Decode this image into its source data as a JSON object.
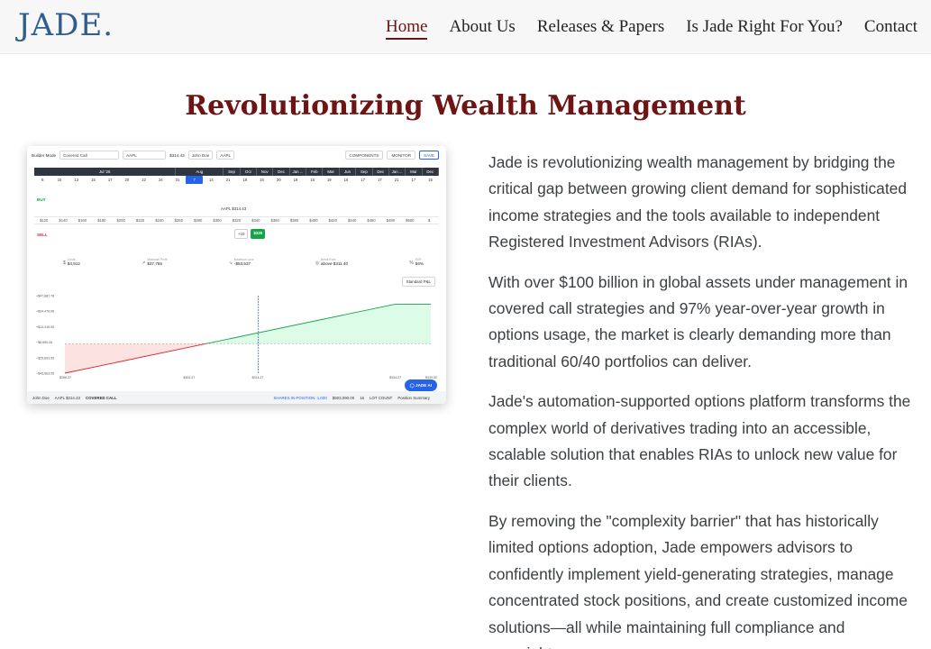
{
  "header": {
    "logo": "JADE.",
    "nav": [
      {
        "label": "Home",
        "active": true
      },
      {
        "label": "About Us"
      },
      {
        "label": "Releases & Papers"
      },
      {
        "label": "Is Jade Right For You?"
      },
      {
        "label": "Contact"
      }
    ]
  },
  "title": "Revolutionizing Wealth Management",
  "screenshot": {
    "toolbar": {
      "builder_mode_label": "Builder Mode",
      "strategy": "Covered Call",
      "ticker": "AAPL",
      "price": "$314.43",
      "client": "John Doe",
      "ticker_chip": "AAPL",
      "components": "COMPONENTS",
      "monitor": "MONITOR",
      "save": "SAVE"
    },
    "months": [
      {
        "label": "Jul '26",
        "weight": 9
      },
      {
        "label": "Aug",
        "weight": 3
      },
      {
        "label": "Sep",
        "weight": 1
      },
      {
        "label": "Oct",
        "weight": 1
      },
      {
        "label": "Nov",
        "weight": 1
      },
      {
        "label": "Dec",
        "weight": 1
      },
      {
        "label": "Jan ...",
        "weight": 1
      },
      {
        "label": "Feb",
        "weight": 1
      },
      {
        "label": "Mar",
        "weight": 1
      },
      {
        "label": "Jun",
        "weight": 1
      },
      {
        "label": "Sep",
        "weight": 1
      },
      {
        "label": "Dec",
        "weight": 1
      },
      {
        "label": "Jan ...",
        "weight": 1
      },
      {
        "label": "Mar",
        "weight": 1
      },
      {
        "label": "Dec",
        "weight": 1
      }
    ],
    "days": [
      "6",
      "10",
      "13",
      "15",
      "17",
      "20",
      "22",
      "24",
      "31",
      "7",
      "14",
      "21",
      "18",
      "16",
      "20",
      "18",
      "15",
      "19",
      "16",
      "17",
      "17",
      "21",
      "17",
      "15"
    ],
    "selected_day_index": 9,
    "buy_label": "BUY",
    "sell_label": "SELL",
    "ticker_label": "AAPL $314.43",
    "strikes": [
      "$120",
      "$140",
      "$160",
      "$180",
      "$200",
      "$220",
      "$240",
      "$260",
      "$280",
      "$300",
      "$320",
      "$340",
      "$360",
      "$380",
      "$400",
      "$420",
      "$440",
      "$460",
      "$480",
      "$500",
      "$"
    ],
    "chips": [
      "+10",
      "$320"
    ],
    "stats": [
      {
        "label": "Credit",
        "value": "$4,912"
      },
      {
        "label": "Maximum Profit",
        "value": "$37,755"
      },
      {
        "label": "Maximum Loss",
        "value": "-$53,537"
      },
      {
        "label": "Break Even",
        "value": "above $311.40"
      },
      {
        "label": "POP",
        "value": "56%"
      }
    ],
    "pnl_dropdown": "Standard P&L",
    "chart_data": {
      "type": "line",
      "y_ticks": [
        "+$47,887.78",
        "+$34,476.96",
        "+$14,416.06",
        "−$8,690.06",
        "−$25,603.95",
        "−$43,563.05"
      ],
      "x_ticks": [
        "$286.27",
        "$304.27",
        "$314.27",
        "$334.27",
        "$339.50"
      ],
      "payoff_points": [
        {
          "x": 286.27,
          "y": -43563.05
        },
        {
          "x": 334.27,
          "y": 37755
        },
        {
          "x": 339.5,
          "y": 37755
        }
      ],
      "breakeven_line": "-8690.06",
      "current_price_marker": 314.43
    },
    "footer": {
      "client": "John Doe",
      "ticker": "AAPL $314.43",
      "strategy": "COVERED CALL",
      "shares": "SHARES IN POSITION: 1,000",
      "position_value": "$503,090.00",
      "lots": "16",
      "lot_count": "LOT COUNT",
      "summary": "Position Summary"
    },
    "ai_button": "JADE AI"
  },
  "paragraphs": [
    "Jade is revolutionizing wealth management by bridging the critical gap between growing client demand for sophisticated income strategies and the tools available to independent Registered Investment Advisors (RIAs).",
    "With over $100 billion in global assets under management in covered call strategies and 97% year-over-year growth in options usage, the market is clearly demanding more than traditional 60/40 portfolios can deliver.",
    "Jade's automation-supported options platform transforms the complex world of derivatives trading into an accessible, scalable solution that enables RIAs to unlock new value for their clients.",
    "By removing the \"complexity barrier\" that has historically limited options adoption, Jade empowers advisors to confidently implement yield-generating strategies, manage concentrated stock positions, and create customized income solutions—all while maintaining full compliance and oversight."
  ]
}
